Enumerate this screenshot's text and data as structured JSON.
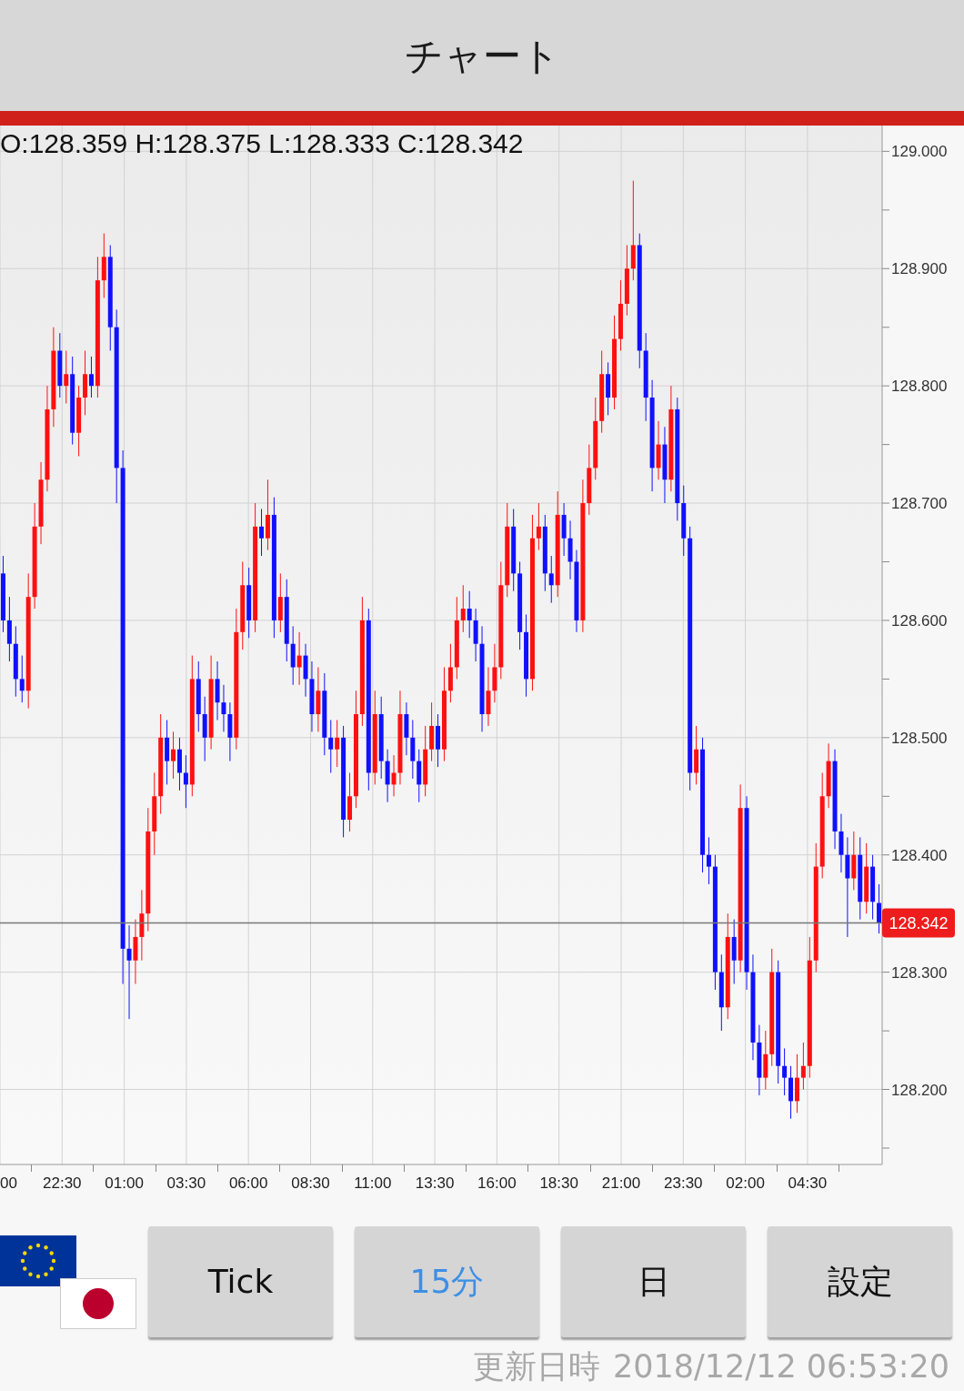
{
  "title": "チャート",
  "ohlc": "O:128.359 H:128.375 L:128.333 C:128.342",
  "chart": {
    "chart_data": {
      "type": "candlestick",
      "categories": [
        null,
        null,
        null,
        null,
        null,
        null,
        null,
        null,
        null,
        null,
        null,
        null,
        null,
        null,
        null,
        null,
        null,
        null,
        null,
        null,
        null,
        null,
        null,
        null,
        null,
        null,
        null,
        null,
        null,
        null,
        null,
        null,
        null,
        null,
        null,
        null,
        null,
        null,
        null,
        null,
        null,
        null,
        null,
        null,
        null,
        null,
        null,
        null,
        null,
        null,
        null,
        null,
        null,
        null,
        null,
        null,
        null,
        null,
        null,
        null,
        null,
        null,
        null,
        null,
        null,
        null,
        null,
        null,
        null,
        null,
        null,
        null,
        null,
        null,
        null,
        null,
        null,
        null,
        null,
        null,
        null,
        null,
        null,
        null,
        null,
        null,
        null,
        null,
        null,
        null,
        null,
        null,
        null,
        null,
        null,
        null,
        null,
        null,
        null,
        null,
        null,
        null,
        null,
        null,
        null,
        null,
        null,
        null,
        null,
        null,
        null,
        null,
        null,
        null,
        null,
        null,
        null,
        null,
        null,
        null,
        null,
        null,
        null,
        null,
        null,
        null,
        null,
        null,
        null,
        null,
        null,
        null,
        null,
        null,
        null,
        null,
        null,
        null,
        null,
        null
      ],
      "grid": true,
      "ohlc": [
        [
          128.64,
          128.655,
          128.59,
          128.6
        ],
        [
          128.6,
          128.62,
          128.565,
          128.58
        ],
        [
          128.58,
          128.595,
          128.535,
          128.55
        ],
        [
          128.55,
          128.57,
          128.53,
          128.54
        ],
        [
          128.54,
          128.64,
          128.525,
          128.62
        ],
        [
          128.62,
          128.7,
          128.61,
          128.68
        ],
        [
          128.68,
          128.735,
          128.665,
          128.72
        ],
        [
          128.72,
          128.8,
          128.71,
          128.78
        ],
        [
          128.78,
          128.85,
          128.765,
          128.83
        ],
        [
          128.83,
          128.845,
          128.79,
          128.8
        ],
        [
          128.8,
          128.83,
          128.785,
          128.81
        ],
        [
          128.81,
          128.825,
          128.75,
          128.76
        ],
        [
          128.76,
          128.8,
          128.74,
          128.79
        ],
        [
          128.79,
          128.83,
          128.775,
          128.81
        ],
        [
          128.81,
          128.825,
          128.79,
          128.8
        ],
        [
          128.8,
          128.91,
          128.79,
          128.89
        ],
        [
          128.89,
          128.93,
          128.875,
          128.91
        ],
        [
          128.91,
          128.92,
          128.83,
          128.85
        ],
        [
          128.85,
          128.865,
          128.7,
          128.73
        ],
        [
          128.73,
          128.745,
          128.29,
          128.32
        ],
        [
          128.32,
          128.34,
          128.26,
          128.31
        ],
        [
          128.31,
          128.345,
          128.29,
          128.33
        ],
        [
          128.33,
          128.37,
          128.31,
          128.35
        ],
        [
          128.35,
          128.44,
          128.335,
          128.42
        ],
        [
          128.42,
          128.47,
          128.4,
          128.45
        ],
        [
          128.45,
          128.52,
          128.435,
          128.5
        ],
        [
          128.5,
          128.515,
          128.46,
          128.48
        ],
        [
          128.48,
          128.505,
          128.465,
          128.49
        ],
        [
          128.49,
          128.5,
          128.455,
          128.47
        ],
        [
          128.47,
          128.485,
          128.44,
          128.46
        ],
        [
          128.46,
          128.57,
          128.45,
          128.55
        ],
        [
          128.55,
          128.565,
          128.505,
          128.52
        ],
        [
          128.52,
          128.535,
          128.48,
          128.5
        ],
        [
          128.5,
          128.57,
          128.49,
          128.55
        ],
        [
          128.55,
          128.565,
          128.515,
          128.53
        ],
        [
          128.53,
          128.545,
          128.505,
          128.52
        ],
        [
          128.52,
          128.53,
          128.48,
          128.5
        ],
        [
          128.5,
          128.61,
          128.49,
          128.59
        ],
        [
          128.59,
          128.65,
          128.575,
          128.63
        ],
        [
          128.63,
          128.645,
          128.585,
          128.6
        ],
        [
          128.6,
          128.7,
          128.59,
          128.68
        ],
        [
          128.68,
          128.695,
          128.655,
          128.67
        ],
        [
          128.67,
          128.72,
          128.66,
          128.69
        ],
        [
          128.69,
          128.705,
          128.585,
          128.6
        ],
        [
          128.6,
          128.64,
          128.59,
          128.62
        ],
        [
          128.62,
          128.635,
          128.565,
          128.58
        ],
        [
          128.58,
          128.595,
          128.545,
          128.56
        ],
        [
          128.56,
          128.59,
          128.545,
          128.57
        ],
        [
          128.57,
          128.58,
          128.535,
          128.55
        ],
        [
          128.55,
          128.565,
          128.505,
          128.52
        ],
        [
          128.52,
          128.56,
          128.505,
          128.54
        ],
        [
          128.54,
          128.555,
          128.485,
          128.5
        ],
        [
          128.5,
          128.515,
          128.47,
          128.49
        ],
        [
          128.49,
          128.515,
          128.475,
          128.5
        ],
        [
          128.5,
          128.51,
          128.415,
          128.43
        ],
        [
          128.43,
          128.47,
          128.42,
          128.45
        ],
        [
          128.45,
          128.54,
          128.44,
          128.52
        ],
        [
          128.52,
          128.62,
          128.51,
          128.6
        ],
        [
          128.6,
          128.61,
          128.455,
          128.47
        ],
        [
          128.47,
          128.54,
          128.46,
          128.52
        ],
        [
          128.52,
          128.535,
          128.465,
          128.48
        ],
        [
          128.48,
          128.49,
          128.445,
          128.46
        ],
        [
          128.46,
          128.485,
          128.45,
          128.47
        ],
        [
          128.47,
          128.54,
          128.46,
          128.52
        ],
        [
          128.52,
          128.53,
          128.485,
          128.5
        ],
        [
          128.5,
          128.515,
          128.465,
          128.48
        ],
        [
          128.48,
          128.49,
          128.445,
          128.46
        ],
        [
          128.46,
          128.51,
          128.45,
          128.49
        ],
        [
          128.49,
          128.53,
          128.48,
          128.51
        ],
        [
          128.51,
          128.52,
          128.475,
          128.49
        ],
        [
          128.49,
          128.56,
          128.48,
          128.54
        ],
        [
          128.54,
          128.58,
          128.53,
          128.56
        ],
        [
          128.56,
          128.62,
          128.55,
          128.6
        ],
        [
          128.6,
          128.63,
          128.59,
          128.61
        ],
        [
          128.61,
          128.625,
          128.585,
          128.6
        ],
        [
          128.6,
          128.61,
          128.565,
          128.58
        ],
        [
          128.58,
          128.595,
          128.505,
          128.52
        ],
        [
          128.52,
          128.56,
          128.51,
          128.54
        ],
        [
          128.54,
          128.58,
          128.53,
          128.56
        ],
        [
          128.56,
          128.65,
          128.55,
          128.63
        ],
        [
          128.63,
          128.7,
          128.62,
          128.68
        ],
        [
          128.68,
          128.695,
          128.625,
          128.64
        ],
        [
          128.64,
          128.65,
          128.575,
          128.59
        ],
        [
          128.59,
          128.605,
          128.535,
          128.55
        ],
        [
          128.55,
          128.69,
          128.54,
          128.67
        ],
        [
          128.67,
          128.7,
          128.66,
          128.68
        ],
        [
          128.68,
          128.69,
          128.625,
          128.64
        ],
        [
          128.64,
          128.655,
          128.615,
          128.63
        ],
        [
          128.63,
          128.71,
          128.62,
          128.69
        ],
        [
          128.69,
          128.7,
          128.655,
          128.67
        ],
        [
          128.67,
          128.685,
          128.635,
          128.65
        ],
        [
          128.65,
          128.66,
          128.59,
          128.6
        ],
        [
          128.6,
          128.72,
          128.59,
          128.7
        ],
        [
          128.7,
          128.75,
          128.69,
          128.73
        ],
        [
          128.73,
          128.79,
          128.72,
          128.77
        ],
        [
          128.77,
          128.83,
          128.76,
          128.81
        ],
        [
          128.81,
          128.82,
          128.775,
          128.79
        ],
        [
          128.79,
          128.86,
          128.78,
          128.84
        ],
        [
          128.84,
          128.89,
          128.83,
          128.87
        ],
        [
          128.87,
          128.92,
          128.86,
          128.9
        ],
        [
          128.9,
          128.975,
          128.89,
          128.92
        ],
        [
          128.92,
          128.93,
          128.815,
          128.83
        ],
        [
          128.83,
          128.845,
          128.77,
          128.79
        ],
        [
          128.79,
          128.805,
          128.71,
          128.73
        ],
        [
          128.73,
          128.77,
          128.72,
          128.75
        ],
        [
          128.75,
          128.765,
          128.7,
          128.72
        ],
        [
          128.72,
          128.8,
          128.71,
          128.78
        ],
        [
          128.78,
          128.79,
          128.685,
          128.7
        ],
        [
          128.7,
          128.715,
          128.655,
          128.67
        ],
        [
          128.67,
          128.68,
          128.455,
          128.47
        ],
        [
          128.47,
          128.51,
          128.46,
          128.49
        ],
        [
          128.49,
          128.5,
          128.385,
          128.4
        ],
        [
          128.4,
          128.415,
          128.375,
          128.39
        ],
        [
          128.39,
          128.4,
          128.285,
          128.3
        ],
        [
          128.3,
          128.315,
          128.25,
          128.27
        ],
        [
          128.27,
          128.35,
          128.26,
          128.33
        ],
        [
          128.33,
          128.345,
          128.29,
          128.31
        ],
        [
          128.31,
          128.46,
          128.3,
          128.44
        ],
        [
          128.44,
          128.45,
          128.285,
          128.3
        ],
        [
          128.3,
          128.315,
          128.225,
          128.24
        ],
        [
          128.24,
          128.255,
          128.195,
          128.21
        ],
        [
          128.21,
          128.25,
          128.2,
          128.23
        ],
        [
          128.23,
          128.32,
          128.22,
          128.3
        ],
        [
          128.3,
          128.31,
          128.205,
          128.22
        ],
        [
          128.22,
          128.235,
          128.195,
          128.21
        ],
        [
          128.21,
          128.22,
          128.175,
          128.19
        ],
        [
          128.19,
          128.23,
          128.18,
          128.21
        ],
        [
          128.21,
          128.24,
          128.2,
          128.22
        ],
        [
          128.22,
          128.33,
          128.21,
          128.31
        ],
        [
          128.31,
          128.41,
          128.3,
          128.39
        ],
        [
          128.39,
          128.47,
          128.38,
          128.45
        ],
        [
          128.45,
          128.495,
          128.44,
          128.48
        ],
        [
          128.48,
          128.49,
          128.405,
          128.42
        ],
        [
          128.42,
          128.435,
          128.385,
          128.4
        ],
        [
          128.4,
          128.415,
          128.33,
          128.38
        ],
        [
          128.38,
          128.42,
          128.37,
          128.4
        ],
        [
          128.4,
          128.415,
          128.345,
          128.36
        ],
        [
          128.36,
          128.41,
          128.35,
          128.39
        ],
        [
          128.39,
          128.4,
          128.345,
          128.36
        ],
        [
          128.359,
          128.375,
          128.333,
          128.342
        ]
      ],
      "ylim": [
        128.136,
        129.022
      ],
      "yticks": [
        {
          "value": 129.0,
          "label": "129.000"
        },
        {
          "value": 128.9,
          "label": "128.900"
        },
        {
          "value": 128.8,
          "label": "128.800"
        },
        {
          "value": 128.7,
          "label": "128.700"
        },
        {
          "value": 128.6,
          "label": "128.600"
        },
        {
          "value": 128.5,
          "label": "128.500"
        },
        {
          "value": 128.4,
          "label": "128.400"
        },
        {
          "value": 128.3,
          "label": "128.300"
        },
        {
          "value": 128.2,
          "label": "128.200"
        }
      ],
      "ref_lines": [
        {
          "axis": "y",
          "value": 128.342,
          "label": "128.342"
        }
      ]
    },
    "time_axis": [
      "00",
      "22:30",
      "01:00",
      "03:30",
      "06:00",
      "08:30",
      "11:00",
      "13:30",
      "16:00",
      "18:30",
      "21:00",
      "23:30",
      "02:00",
      "04:30"
    ]
  },
  "buttons": [
    {
      "label": "Tick",
      "selected": false
    },
    {
      "label": "15分",
      "selected": true
    },
    {
      "label": "日",
      "selected": false
    },
    {
      "label": "設定",
      "selected": false
    }
  ],
  "updated": {
    "label": "更新日時",
    "value": "2018/12/12 06:53:20"
  }
}
